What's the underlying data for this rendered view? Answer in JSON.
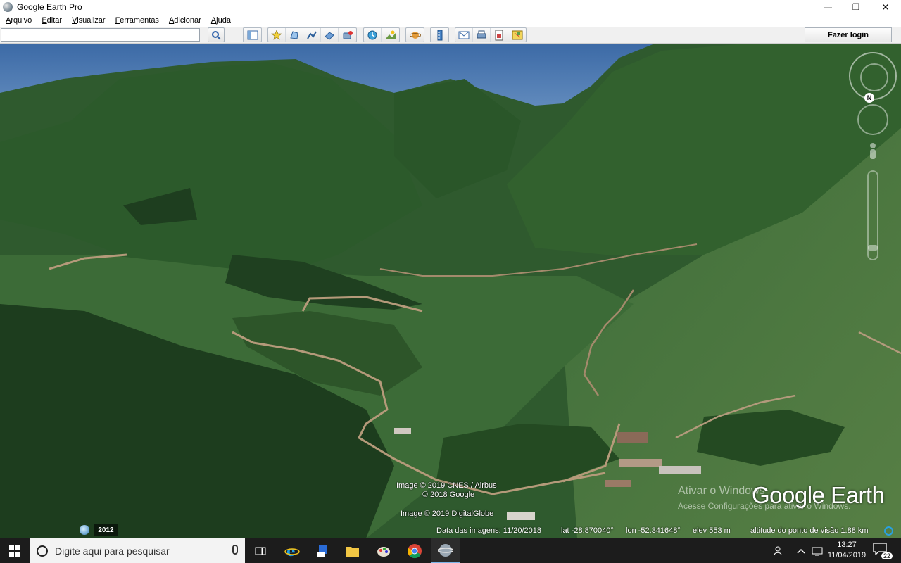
{
  "window": {
    "title": "Google Earth Pro",
    "controls": {
      "minimize": "—",
      "maximize": "❐",
      "close": "✕"
    }
  },
  "menu": [
    "Arquivo",
    "Editar",
    "Visualizar",
    "Ferramentas",
    "Adicionar",
    "Ajuda"
  ],
  "toolbar": {
    "search_value": "",
    "login_label": "Fazer login",
    "buttons": [
      "sidebar",
      "add-placemark",
      "add-polygon",
      "add-path",
      "add-image-overlay",
      "record-tour",
      "historical-imagery",
      "sunlight",
      "switch-to-sky",
      "ruler",
      "email",
      "print",
      "save-image",
      "view-in-maps"
    ]
  },
  "viewport": {
    "attribution": [
      "Image © 2019 CNES / Airbus",
      "© 2018 Google",
      "Image © 2019 DigitalGlobe"
    ],
    "logo": "Google Earth",
    "watermark_title": "Ativar o Windows",
    "watermark_sub": "Acesse Configurações para ativar o Windows.",
    "north_label": "N",
    "year": "2012",
    "status": {
      "image_date": "Data das imagens: 11/20/2018",
      "lat": "lat  -28.870040°",
      "lon": "lon  -52.341648°",
      "elev": "elev   553 m",
      "eye_alt": "altitude do ponto de visão   1.88 km"
    }
  },
  "taskbar": {
    "search_placeholder": "Digite aqui para pesquisar",
    "apps": [
      "task-view",
      "internet-explorer",
      "app-blue",
      "file-explorer",
      "paint",
      "chrome",
      "google-earth"
    ],
    "time": "13:27",
    "date": "11/04/2019",
    "notifications": "22"
  }
}
